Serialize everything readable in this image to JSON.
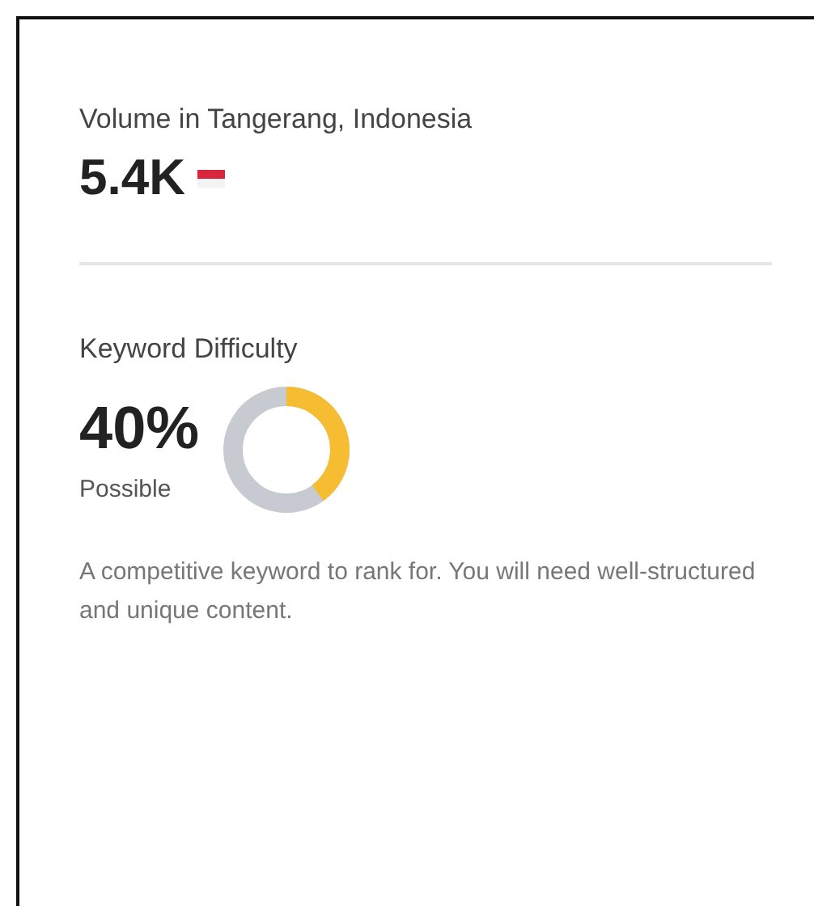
{
  "volume": {
    "label": "Volume in Tangerang, Indonesia",
    "value": "5.4K"
  },
  "keyword_difficulty": {
    "label": "Keyword Difficulty",
    "value": "40%",
    "level": 0.4,
    "rating": "Possible",
    "description": "A competitive keyword to rank for. You will need well-structured and unique content."
  }
}
